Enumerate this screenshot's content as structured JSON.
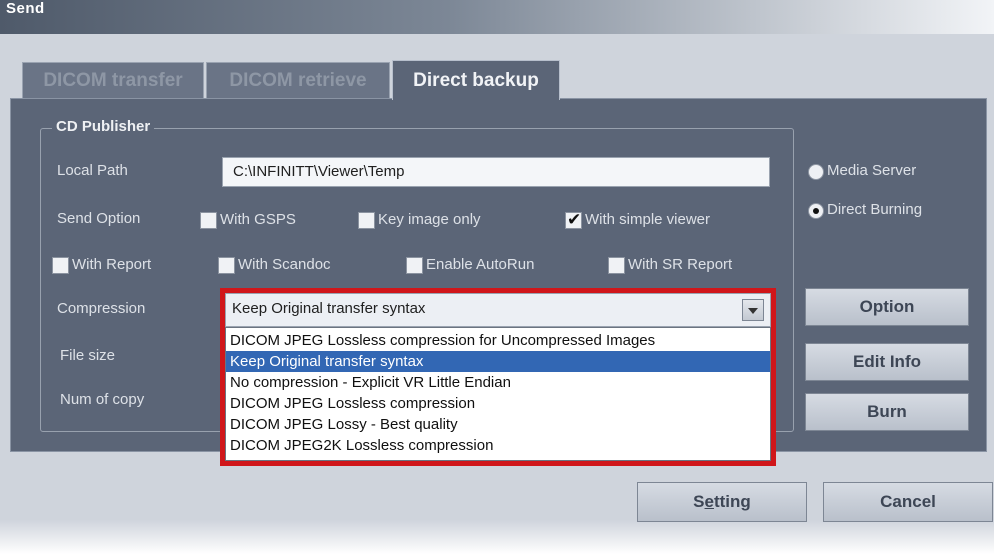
{
  "window": {
    "title": "Send"
  },
  "tabs": [
    {
      "label": "DICOM transfer",
      "active": false
    },
    {
      "label": "DICOM retrieve",
      "active": false
    },
    {
      "label": "Direct backup",
      "active": true
    }
  ],
  "cd_publisher": {
    "group_label": "CD Publisher",
    "local_path": {
      "label": "Local Path",
      "value": "C:\\INFINITT\\Viewer\\Temp"
    },
    "send_option": {
      "label": "Send Option",
      "options": [
        {
          "label": "With GSPS",
          "checked": false
        },
        {
          "label": "Key image only",
          "checked": false
        },
        {
          "label": "With simple viewer",
          "checked": true
        },
        {
          "label": "With Report",
          "checked": false
        },
        {
          "label": "With Scandoc",
          "checked": false
        },
        {
          "label": "Enable AutoRun",
          "checked": false
        },
        {
          "label": "With SR Report",
          "checked": false
        }
      ]
    },
    "compression": {
      "label": "Compression",
      "selected": "Keep Original transfer syntax",
      "options": [
        "DICOM JPEG Lossless compression for Uncompressed Images",
        "Keep Original transfer syntax",
        "No compression - Explicit VR Little Endian",
        "DICOM JPEG Lossless compression",
        "DICOM JPEG Lossy - Best quality",
        "DICOM JPEG2K Lossless compression"
      ],
      "highlighted_index": 1
    },
    "file_size": {
      "label": "File size"
    },
    "num_of_copy": {
      "label": "Num of copy"
    }
  },
  "media": {
    "options": [
      {
        "label": "Media Server",
        "selected": false
      },
      {
        "label": "Direct Burning",
        "selected": true
      }
    ]
  },
  "buttons": {
    "option": "Option",
    "edit_info": "Edit Info",
    "burn": "Burn",
    "setting_pre": "S",
    "setting_u": "e",
    "setting_post": "tting",
    "cancel": "Cancel"
  },
  "colors": {
    "panel": "#5b6577",
    "highlight": "#3267b4",
    "frame_red": "#d0161a"
  }
}
